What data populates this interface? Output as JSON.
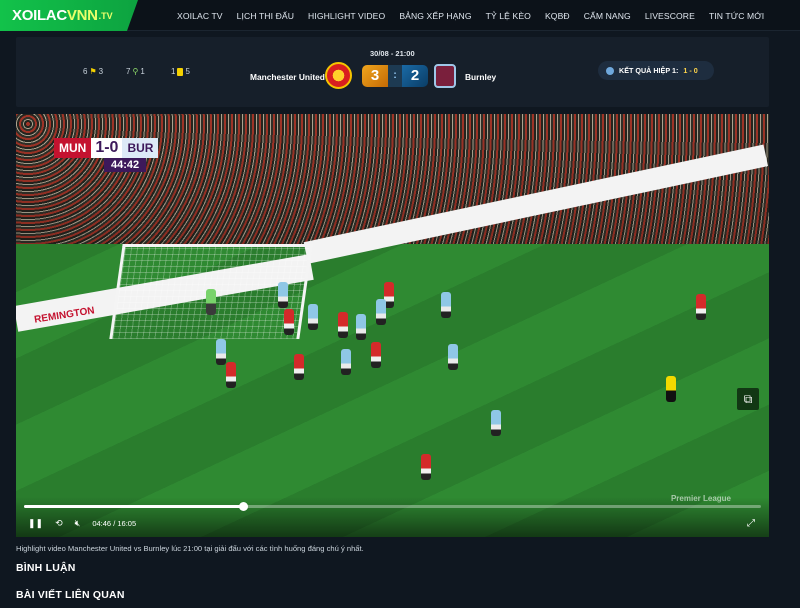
{
  "logo": {
    "part1": "XOILAC",
    "part2": "VNN",
    "part3": ".TV"
  },
  "nav": [
    "XOILAC TV",
    "LỊCH THI ĐẤU",
    "HIGHLIGHT VIDEO",
    "BẢNG XẾP HẠNG",
    "TỶ LỆ KÈO",
    "KQBĐ",
    "CẨM NANG",
    "LIVESCORE",
    "TIN TỨC MỚI"
  ],
  "match": {
    "stats": {
      "corners": "6",
      "corners2": "3",
      "shots": "7",
      "shots2": "1",
      "cards": "1",
      "cards2": "5"
    },
    "home": "Manchester United",
    "away": "Burnley",
    "datetime": "30/08 - 21:00",
    "home_score": "3",
    "away_score": "2",
    "separator": ":",
    "halftime_label": "KẾT QUẢ HIỆP 1:",
    "halftime_value": "1 - 0"
  },
  "video": {
    "bug_home": "MUN",
    "bug_score": "1-0",
    "bug_away": "BUR",
    "clock": "44:42",
    "time_current": "04:46",
    "time_sep": "/",
    "time_total": "16:05",
    "progress": 0.297,
    "watermark": "Premier League",
    "board_text": "REMINGTON"
  },
  "caption": "Highlight video Manchester United vs Burnley lúc 21:00 tại giải đấu với các tình huống đáng chú ý nhất.",
  "sections": {
    "comments": "BÌNH LUẬN",
    "related": "BÀI VIẾT LIÊN QUAN"
  },
  "colors": {
    "brand_green": "#12c24a",
    "accent_yellow": "#eaff6a",
    "home_score_bg": "#f0a51d",
    "away_score_bg": "#1a6aa6"
  }
}
